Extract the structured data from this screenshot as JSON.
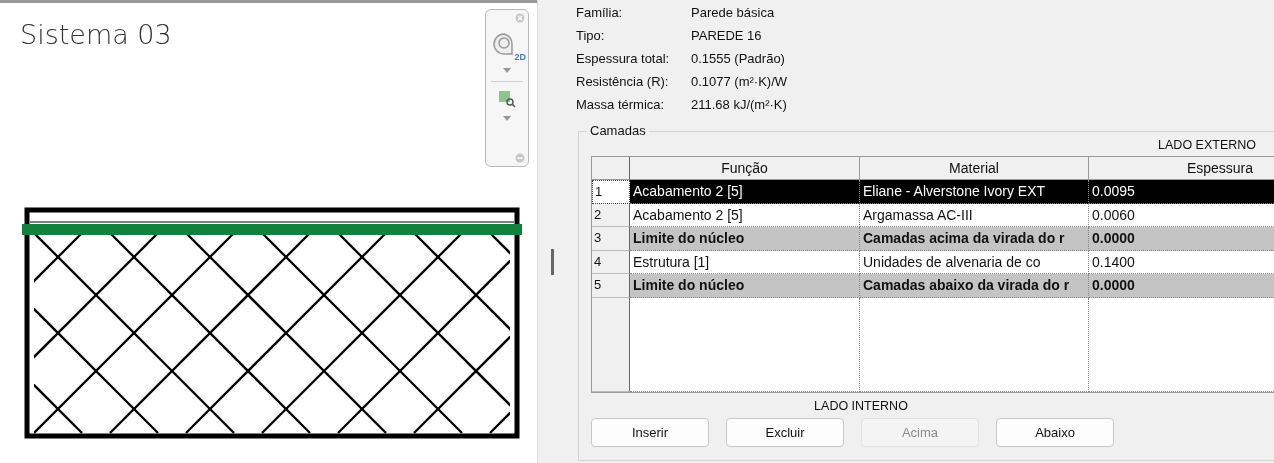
{
  "view_title": "Sistema 03",
  "nav_bar": {
    "zoom_badge": "2D"
  },
  "properties": [
    {
      "label": "Família:",
      "value": "Parede básica"
    },
    {
      "label": "Tipo:",
      "value": "PAREDE 16"
    },
    {
      "label": "Espessura total:",
      "value": "0.1555 (Padrão)"
    },
    {
      "label": "Resistência (R):",
      "value": "0.1077 (m²·K)/W"
    },
    {
      "label": "Massa térmica:",
      "value": "211.68 kJ/(m²·K)"
    }
  ],
  "layers": {
    "title": "Camadas",
    "outer_side_label": "LADO EXTERNO",
    "columns": [
      "Função",
      "Material",
      "Espessura"
    ],
    "rows": [
      {
        "number": "1",
        "function": "Acabamento 2 [5]",
        "material": "Eliane - Alverstone Ivory EXT",
        "thickness": "0.0095",
        "kind": "layer",
        "selected": true
      },
      {
        "number": "2",
        "function": "Acabamento 2 [5]",
        "material": "Argamassa AC-III",
        "thickness": "0.0060",
        "kind": "layer",
        "selected": false
      },
      {
        "number": "3",
        "function": "Limite do núcleo",
        "material": "Camadas acima da virada do r",
        "thickness": "0.0000",
        "kind": "core_boundary",
        "selected": false
      },
      {
        "number": "4",
        "function": "Estrutura [1]",
        "material": "Unidades de alvenaria de co",
        "thickness": "0.1400",
        "kind": "layer",
        "selected": false
      },
      {
        "number": "5",
        "function": "Limite do núcleo",
        "material": "Camadas abaixo da virada do r",
        "thickness": "0.0000",
        "kind": "core_boundary",
        "selected": false
      }
    ],
    "inner_side_label": "LADO INTERNO",
    "buttons": [
      {
        "label": "Inserir",
        "disabled": false
      },
      {
        "label": "Excluir",
        "disabled": false
      },
      {
        "label": "Acima",
        "disabled": true
      },
      {
        "label": "Abaixo",
        "disabled": false
      }
    ]
  }
}
